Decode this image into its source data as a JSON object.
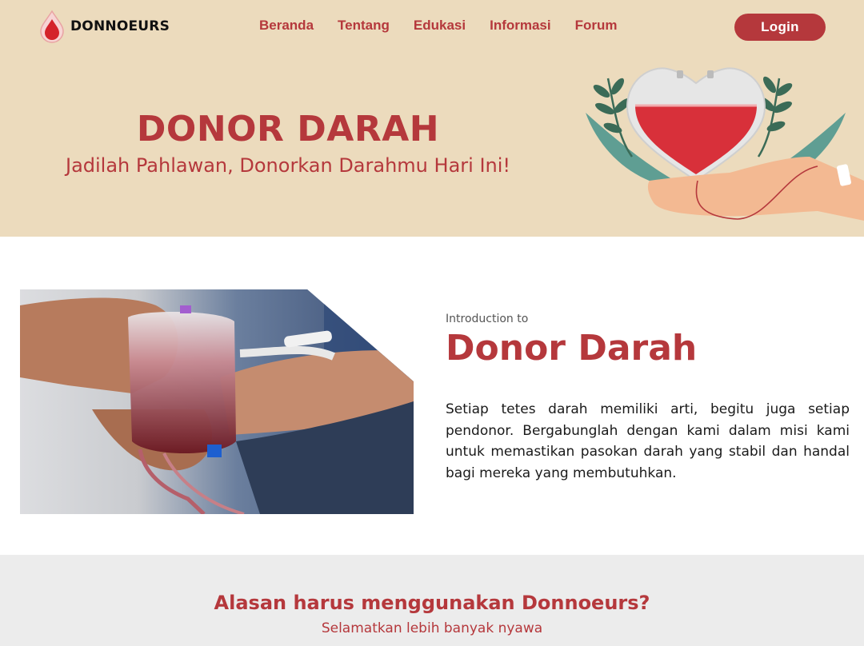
{
  "brand": {
    "name": "DONNOEURS",
    "logo_icon": "blood-drop-icon"
  },
  "nav": {
    "items": [
      {
        "label": "Beranda"
      },
      {
        "label": "Tentang"
      },
      {
        "label": "Edukasi"
      },
      {
        "label": "Informasi"
      },
      {
        "label": "Forum"
      }
    ],
    "login_label": "Login"
  },
  "hero": {
    "title": "DONOR DARAH",
    "subtitle": "Jadilah Pahlawan, Donorkan Darahmu Hari Ini!",
    "illustration": "blood-bag-heart-in-hand-illustration"
  },
  "intro": {
    "kicker": "Introduction to",
    "title": "Donor Darah",
    "body": "Setiap tetes darah memiliki arti, begitu juga setiap pendonor. Bergabunglah dengan kami dalam misi kami untuk memastikan pasokan darah yang stabil dan handal bagi mereka yang membutuhkan.",
    "photo": "hand-holding-blood-bag-photo"
  },
  "reasons": {
    "title": "Alasan harus menggunakan Donnoeurs?",
    "subtitle": "Selamatkan lebih banyak nyawa"
  },
  "colors": {
    "brand": "#b5383c",
    "hero_bg": "#ecdbbd",
    "section_bg": "#ececec"
  }
}
